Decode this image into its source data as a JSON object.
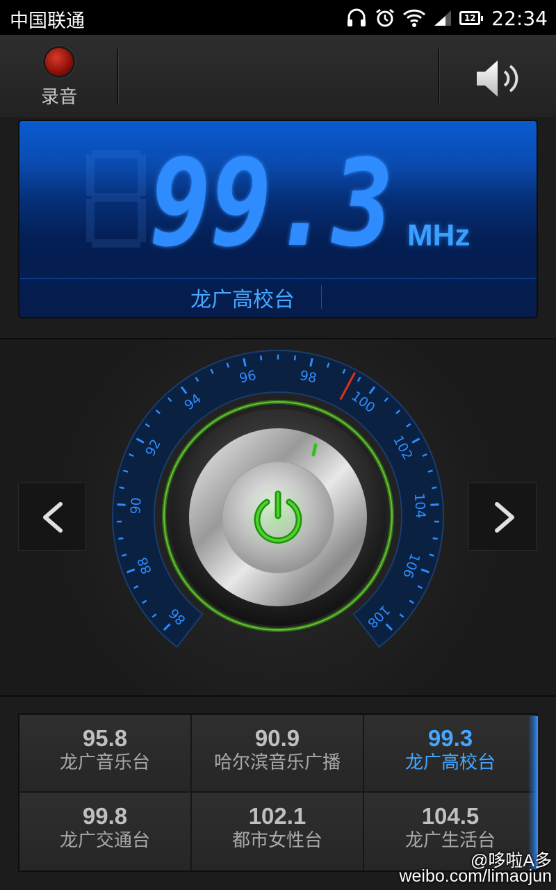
{
  "status_bar": {
    "carrier": "中国联通",
    "icons": [
      "headset-icon",
      "alarm-icon",
      "wifi-icon",
      "signal-icon",
      "battery-icon"
    ],
    "battery_level": "12",
    "time": "22:34"
  },
  "toolbar": {
    "record_label": "录音",
    "speaker_icon": "speaker-icon"
  },
  "display": {
    "frequency": "99.3",
    "unit": "MHz",
    "station_name": "龙广高校台",
    "accent_color": "#3aa0ff"
  },
  "dial": {
    "scale_labels": [
      "86",
      "88",
      "90",
      "92",
      "94",
      "96",
      "98",
      "100",
      "102",
      "104",
      "106",
      "108"
    ],
    "min_mhz": 86,
    "max_mhz": 108,
    "current_mhz": 99.3,
    "power_icon": "power-icon"
  },
  "navigation": {
    "prev_icon": "chevron-left-icon",
    "next_icon": "chevron-right-icon"
  },
  "presets": [
    {
      "freq": "95.8",
      "name": "龙广音乐台",
      "active": false
    },
    {
      "freq": "90.9",
      "name": "哈尔滨音乐广播",
      "active": false
    },
    {
      "freq": "99.3",
      "name": "龙广高校台",
      "active": true
    },
    {
      "freq": "99.8",
      "name": "龙广交通台",
      "active": false
    },
    {
      "freq": "102.1",
      "name": "都市女性台",
      "active": false
    },
    {
      "freq": "104.5",
      "name": "龙广生活台",
      "active": false
    }
  ],
  "watermark": {
    "line1": "@哆啦A多",
    "line2": "weibo.com/limaojun"
  }
}
